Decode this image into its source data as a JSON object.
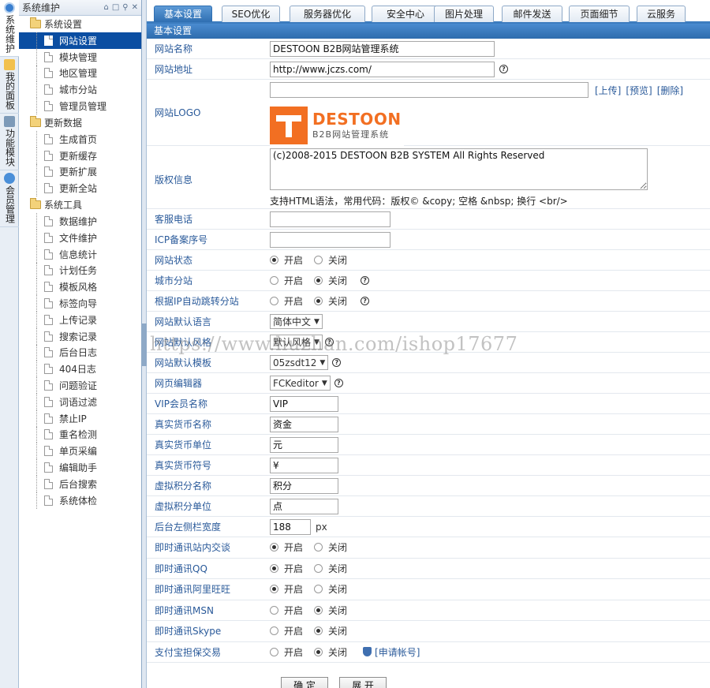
{
  "vtabs": [
    {
      "label": "系统维护",
      "icon": "clock-icon"
    },
    {
      "label": "我的面板",
      "icon": "home-icon"
    },
    {
      "label": "功能模块",
      "icon": "module-icon"
    },
    {
      "label": "会员管理",
      "icon": "user-icon"
    }
  ],
  "tree": {
    "title": "系统维护",
    "groups": [
      {
        "label": "系统设置",
        "items": [
          "网站设置",
          "模块管理",
          "地区管理",
          "城市分站",
          "管理员管理"
        ]
      },
      {
        "label": "更新数据",
        "items": [
          "生成首页",
          "更新缓存",
          "更新扩展",
          "更新全站"
        ]
      },
      {
        "label": "系统工具",
        "items": [
          "数据维护",
          "文件维护",
          "信息统计",
          "计划任务",
          "模板风格",
          "标签向导",
          "上传记录",
          "搜索记录",
          "后台日志",
          "404日志",
          "问题验证",
          "词语过滤",
          "禁止IP",
          "重名检测",
          "单页采编",
          "编辑助手",
          "后台搜索",
          "系统体检"
        ]
      }
    ],
    "selected": "网站设置"
  },
  "tabs": [
    "基本设置",
    "SEO优化",
    "服务器优化",
    "安全中心",
    "图片处理",
    "邮件发送",
    "页面细节",
    "云服务"
  ],
  "section_title": "基本设置",
  "form": {
    "site_name_label": "网站名称",
    "site_name": "DESTOON B2B网站管理系统",
    "site_url_label": "网站地址",
    "site_url": "http://www.jczs.com/",
    "logo_label": "网站LOGO",
    "logo_value": "",
    "logo_upload": "[上传]",
    "logo_preview": "[预览]",
    "logo_delete": "[删除]",
    "logo_brand": "DESTOON",
    "logo_sub": "B2B网站管理系统",
    "copyright_label": "版权信息",
    "copyright": "(c)2008-2015 DESTOON B2B SYSTEM All Rights Reserved",
    "copyright_hint": "支持HTML语法，常用代码：版权© &copy; 空格 &nbsp; 换行 <br/>",
    "tel_label": "客服电话",
    "tel": "",
    "icp_label": "ICP备案序号",
    "icp": "",
    "status_label": "网站状态",
    "city_label": "城市分站",
    "ip_jump_label": "根据IP自动跳转分站",
    "lang_label": "网站默认语言",
    "lang": "简体中文",
    "style_label": "网站默认风格",
    "style": "默认风格",
    "template_label": "网站默认模板",
    "template": "05zsdt12",
    "editor_label": "网页编辑器",
    "editor": "FCKeditor",
    "vip_label": "VIP会员名称",
    "vip": "VIP",
    "money_name_label": "真实货币名称",
    "money_name": "资金",
    "money_unit_label": "真实货币单位",
    "money_unit": "元",
    "money_sign_label": "真实货币符号",
    "money_sign": "¥",
    "credit_name_label": "虚拟积分名称",
    "credit_name": "积分",
    "credit_unit_label": "虚拟积分单位",
    "credit_unit": "点",
    "sidebar_width_label": "后台左侧栏宽度",
    "sidebar_width": "188",
    "sidebar_width_unit": "px",
    "im_web_label": "即时通讯站内交谈",
    "im_qq_label": "即时通讯QQ",
    "im_ali_label": "即时通讯阿里旺旺",
    "im_msn_label": "即时通讯MSN",
    "im_skype_label": "即时通讯Skype",
    "trade_label": "支付宝担保交易",
    "trade_apply": "[申请帐号]",
    "on": "开启",
    "off": "关闭"
  },
  "radios": {
    "status": "on",
    "city": "off",
    "ip_jump": "off",
    "im_web": "on",
    "im_qq": "on",
    "im_ali": "on",
    "im_msn": "off",
    "im_skype": "off",
    "trade": "off"
  },
  "buttons": {
    "submit": "确 定",
    "expand": "展 开"
  },
  "watermark": "https://www.huzhan.com/ishop17677"
}
